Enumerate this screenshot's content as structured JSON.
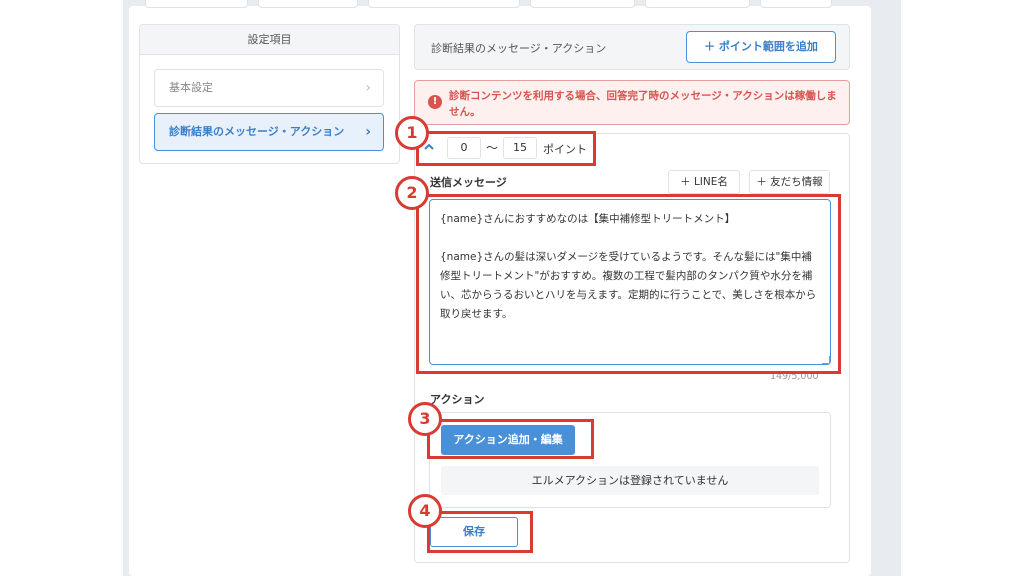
{
  "sidebar": {
    "header": "設定項目",
    "items": [
      {
        "label": "基本設定",
        "chevron": "›"
      },
      {
        "label": "診断結果のメッセージ・アクション",
        "chevron": "›"
      }
    ]
  },
  "main": {
    "title": "診断結果のメッセージ・アクション",
    "add_range_button": "＋ ポイント範囲を追加"
  },
  "alert": {
    "icon": "!",
    "text": "診断コンテンツを利用する場合、回答完了時のメッセージ・アクションは稼働しません。"
  },
  "range": {
    "collapse_icon": "^",
    "min": "0",
    "separator": "〜",
    "max": "15",
    "unit": "ポイント"
  },
  "message": {
    "label": "送信メッセージ",
    "line_name_button": "＋ LINE名",
    "friend_info_button": "＋ 友だち情報",
    "text": "{name}さんにおすすめなのは【集中補修型トリートメント】\n\n{name}さんの髪は深いダメージを受けているようです。そんな髪には\"集中補修型トリートメント\"がおすすめ。複数の工程で髪内部のタンパク質や水分を補い、芯からうるおいとハリを与えます。定期的に行うことで、美しさを根本から取り戻せます。",
    "char_count": "149/5,000"
  },
  "action": {
    "label": "アクション",
    "add_button": "アクション追加・編集",
    "empty_text": "エルメアクションは登録されていません"
  },
  "save_button": "保存",
  "annotations": [
    "1",
    "2",
    "3",
    "4"
  ],
  "colors": {
    "accent": "#4a90d9",
    "alert": "#d9534f",
    "annotation": "#d93a32"
  }
}
